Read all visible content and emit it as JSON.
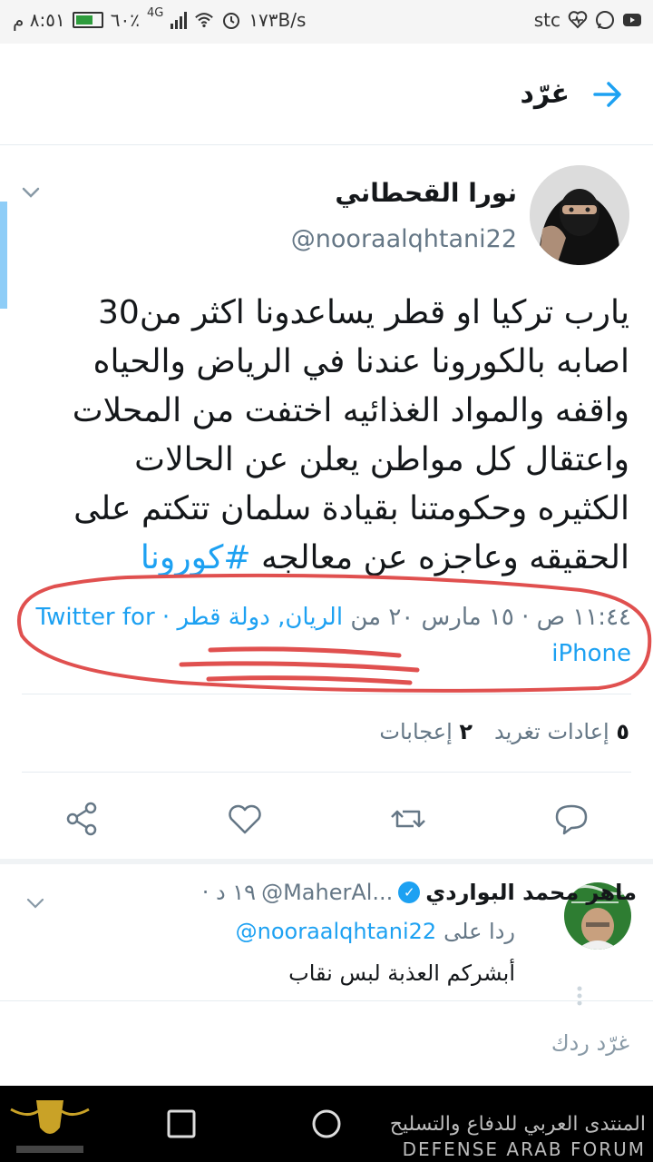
{
  "status_bar": {
    "time": "٨:٥١ م",
    "battery_percent": "٦٠٪",
    "network": "4G",
    "speed": "١٧٣B/s",
    "carrier": "stc",
    "battery_level": 0.6
  },
  "header": {
    "title": "غرّد"
  },
  "tweet": {
    "display_name": "نورا القحطاني",
    "handle": "@nooraalqhtani22",
    "text_lines": [
      "يارب تركيا او قطر يساعدونا اكثر من30",
      "اصابه بالكورونا عندنا في الرياض والحياه",
      "واقفه والمواد الغذائيه اختفت من المحلات",
      "واعتقال كل مواطن يعلن عن الحالات",
      "الكثيره وحكومتنا بقيادة سلمان تتكتم على",
      "الحقيقه وعاجزه عن معالجه"
    ],
    "hashtag": "#كورونا",
    "meta_time": "١١:٤٤ ص · ١٥ مارس ٢٠ من",
    "meta_location": "الريان, دولة قطر",
    "meta_source": "· Twitter for iPhone"
  },
  "stats": {
    "retweets_count": "٥",
    "retweets_label": "إعادات تغريد",
    "likes_count": "٢",
    "likes_label": "إعجابات"
  },
  "reply": {
    "display_name": "ماهر محمد البواردي",
    "handle": "@MaherAl...",
    "time": "١٩ د ·",
    "replying_to_label": "ردا على",
    "replying_to_handle": "@nooraalqhtani22",
    "text": "أبشركم العذبة لبس نقاب"
  },
  "compose": {
    "placeholder": "غرّد ردك"
  },
  "watermark": {
    "arabic": "المنتدى العربي للدفاع والتسليح",
    "english": "DEFENSE ARAB FORUM"
  },
  "colors": {
    "accent": "#1da1f2",
    "annotation": "#e0504f"
  },
  "icons": [
    "arrow-right-icon",
    "chevron-down-icon",
    "share-icon",
    "heart-icon",
    "retweet-icon",
    "reply-icon",
    "verified-icon",
    "square-nav-icon",
    "circle-nav-icon"
  ]
}
